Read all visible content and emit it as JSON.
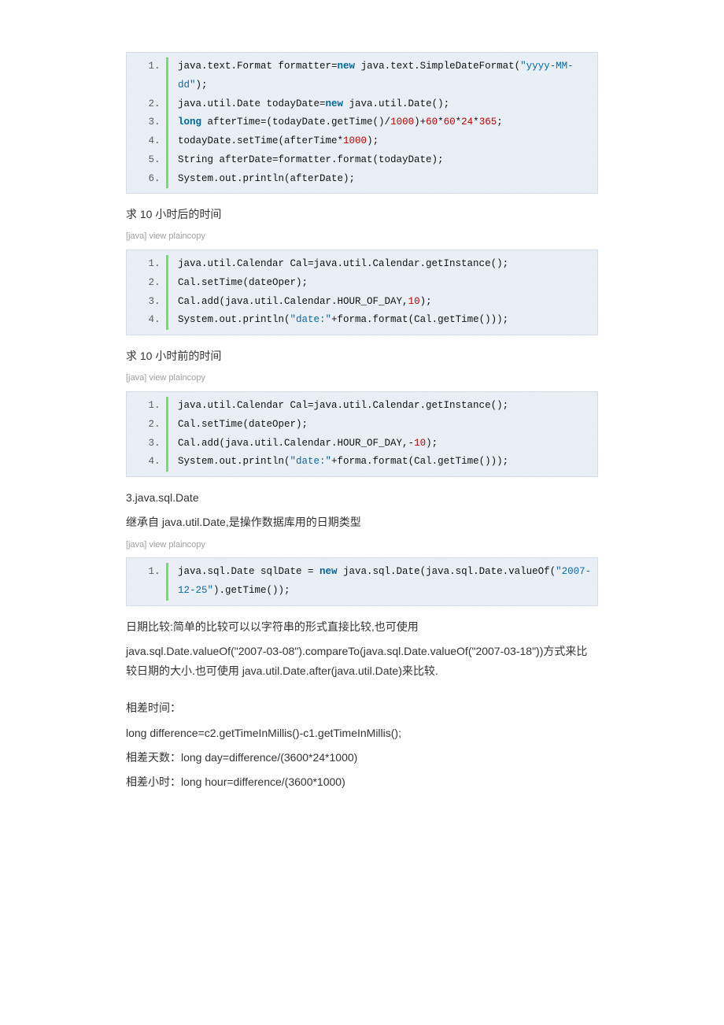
{
  "toolbar_text": "[java] view plaincopy",
  "block1": {
    "l1_a": "java.text.Format formatter=",
    "l1_kw": "new",
    "l1_b": " java.text.SimpleDateFormat(",
    "l1_str": "\"yyyy-MM-dd\"",
    "l1_c": ");  ",
    "l2": "java.util.Date todayDate=",
    "l2_kw": "new",
    "l2_b": " java.util.Date();  ",
    "l3_a": "long",
    "l3_b": " afterTime=(todayDate.getTime()/",
    "l3_n1": "1000",
    "l3_c": ")+",
    "l3_n2": "60",
    "l3_d": "*",
    "l3_n3": "60",
    "l3_e": "*",
    "l3_n4": "24",
    "l3_f": "*",
    "l3_n5": "365",
    "l3_g": ";  ",
    "l4_a": "todayDate.setTime(afterTime*",
    "l4_n": "1000",
    "l4_b": ");  ",
    "l5": "String afterDate=formatter.format(todayDate);  ",
    "l6": "System.out.println(afterDate);  "
  },
  "para1": "求 10 小时后的时间",
  "block2": {
    "l1": "java.util.Calendar Cal=java.util.Calendar.getInstance();  ",
    "l2": "Cal.setTime(dateOper);  ",
    "l3_a": "Cal.add(java.util.Calendar.HOUR_OF_DAY,",
    "l3_n": "10",
    "l3_b": ");  ",
    "l4_a": "System.out.println(",
    "l4_str": "\"date:\"",
    "l4_b": "+forma.format(Cal.getTime()));  "
  },
  "para2": "求 10 小时前的时间",
  "block3": {
    "l1": "java.util.Calendar Cal=java.util.Calendar.getInstance();  ",
    "l2": "Cal.setTime(dateOper);  ",
    "l3_a": "Cal.add(java.util.Calendar.HOUR_OF_DAY,-",
    "l3_n": "10",
    "l3_b": ");  ",
    "l4_a": "System.out.println(",
    "l4_str": "\"date:\"",
    "l4_b": "+forma.format(Cal.getTime()));  "
  },
  "para3a": "3.java.sql.Date",
  "para3b": "继承自 java.util.Date,是操作数据库用的日期类型",
  "block4": {
    "l1_a": "java.sql.Date sqlDate = ",
    "l1_kw": "new",
    "l1_b": " java.sql.Date(java.sql.Date.valueOf(",
    "l1_str": "\"2007-12-25\"",
    "l1_c": ").getTime());  "
  },
  "para4a": "日期比较:简单的比较可以以字符串的形式直接比较,也可使用",
  "para4b": "java.sql.Date.valueOf(\"2007-03-08\").compareTo(java.sql.Date.valueOf(\"2007-03-18\"))方式来比较日期的大小.也可使用 java.util.Date.after(java.util.Date)来比较.",
  "para5a": "相差时间：",
  "para5b": "long difference=c2.getTimeInMillis()-c1.getTimeInMillis();",
  "para5c": "相差天数：long day=difference/(3600*24*1000)",
  "para5d": "相差小时：long hour=difference/(3600*1000)"
}
